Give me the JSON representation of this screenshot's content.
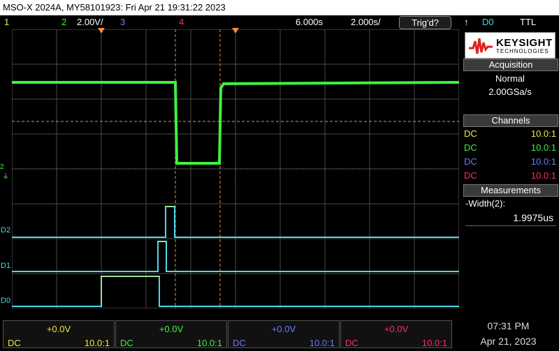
{
  "title": "MSO-X 2024A, MY58101923: Fri Apr 21 19:31:22 2023",
  "topbar": {
    "ch1_num": "1",
    "ch2_num": "2",
    "ch2_scale": "2.00V/",
    "ch3_num": "3",
    "ch4_num": "4",
    "trigger_delay": "6.000s",
    "timebase": "2.000s/",
    "trig_status": "Trig'd?",
    "trig_source": "D0",
    "trig_level": "TTL"
  },
  "markers": {
    "ch2_ground": "2",
    "d2": "D2",
    "d1": "D1",
    "d0": "D0"
  },
  "side": {
    "brand": "KEYSIGHT",
    "brand_sub": "TECHNOLOGIES",
    "acq_title": "Acquisition",
    "acq_mode": "Normal",
    "acq_rate": "2.00GSa/s",
    "channels_title": "Channels",
    "channels": [
      {
        "coupling": "DC",
        "probe": "10.0:1",
        "color": "#f2e84a"
      },
      {
        "coupling": "DC",
        "probe": "10.0:1",
        "color": "#3ef23e"
      },
      {
        "coupling": "DC",
        "probe": "10.0:1",
        "color": "#6b7bff"
      },
      {
        "coupling": "DC",
        "probe": "10.0:1",
        "color": "#ff2e6e"
      }
    ],
    "meas_title": "Measurements",
    "meas_label": "-Width(2):",
    "meas_value": "1.9975us"
  },
  "bottom": {
    "channels": [
      {
        "offset": "+0.0V",
        "coupling": "DC",
        "probe": "10.0:1",
        "color": "#f2e84a"
      },
      {
        "offset": "+0.0V",
        "coupling": "DC",
        "probe": "10.0:1",
        "color": "#3ef23e"
      },
      {
        "offset": "+0.0V",
        "coupling": "DC",
        "probe": "10.0:1",
        "color": "#6b7bff"
      },
      {
        "offset": "+0.0V",
        "coupling": "DC",
        "probe": "10.0:1",
        "color": "#ff2e6e"
      }
    ],
    "time": "07:31 PM",
    "date": "Apr 21, 2023"
  },
  "colors": {
    "ch1": "#f2e84a",
    "ch2": "#3ef23e",
    "ch3": "#6b7bff",
    "ch4": "#ff2e6e",
    "digital": "#4fd8e8",
    "cursor": "#ff8a3a"
  }
}
